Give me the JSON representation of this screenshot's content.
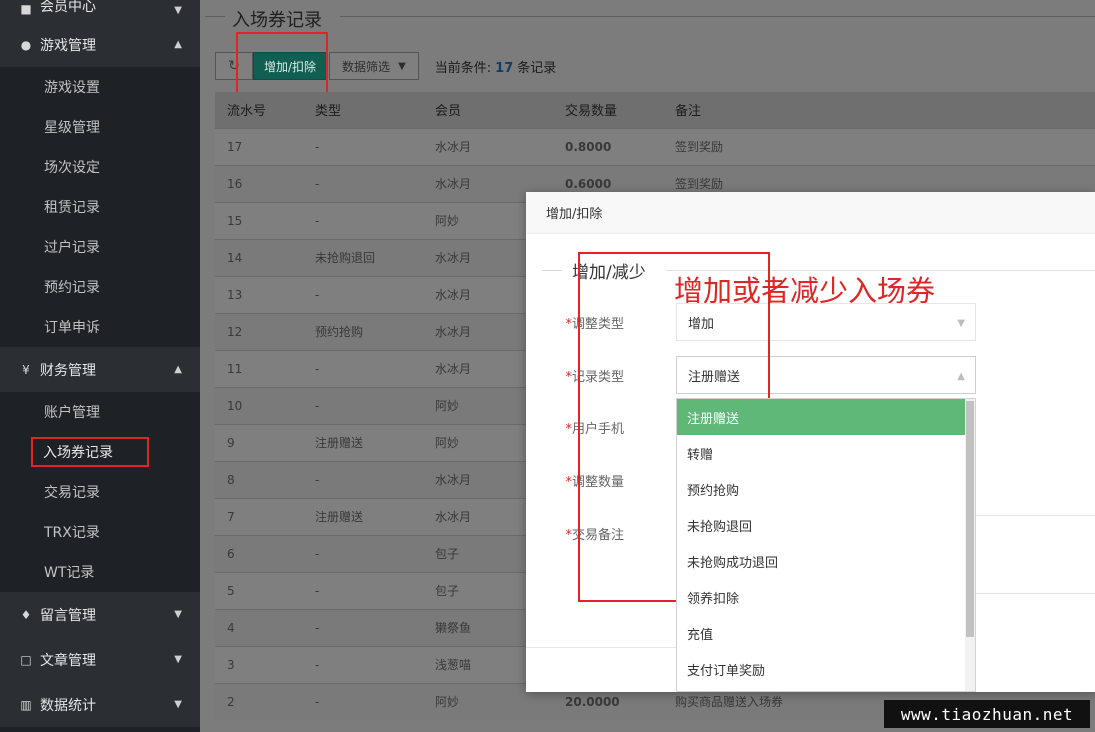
{
  "sidebar": {
    "top_group": {
      "label": "会员中心"
    },
    "groups": [
      {
        "label": "游戏管理",
        "items": [
          "游戏设置",
          "星级管理",
          "场次设定",
          "租赁记录",
          "过户记录",
          "预约记录",
          "订单申诉"
        ]
      },
      {
        "label": "财务管理",
        "icon": "¥",
        "items": [
          "账户管理",
          "入场券记录",
          "交易记录",
          "TRX记录",
          "WT记录"
        ]
      },
      {
        "label": "留言管理",
        "items": []
      },
      {
        "label": "文章管理",
        "items": []
      },
      {
        "label": "数据统计",
        "items": []
      }
    ]
  },
  "main": {
    "page_title": "入场券记录",
    "toolbar": {
      "add_label": "增加/扣除",
      "filter_label": "数据筛选",
      "cond_prefix": "当前条件:",
      "cond_count": "17",
      "cond_suffix": "条记录"
    },
    "table": {
      "headers": [
        "流水号",
        "类型",
        "会员",
        "交易数量",
        "备注"
      ],
      "rows": [
        [
          "17",
          "-",
          "水冰月",
          "0.8000",
          "签到奖励"
        ],
        [
          "16",
          "-",
          "水冰月",
          "0.6000",
          "签到奖励"
        ],
        [
          "15",
          "-",
          "阿妙",
          "",
          ""
        ],
        [
          "14",
          "未抢购退回",
          "水冰月",
          "",
          ""
        ],
        [
          "13",
          "-",
          "水冰月",
          "",
          ""
        ],
        [
          "12",
          "预约抢购",
          "水冰月",
          "",
          ""
        ],
        [
          "11",
          "-",
          "水冰月",
          "",
          ""
        ],
        [
          "10",
          "-",
          "阿妙",
          "",
          ""
        ],
        [
          "9",
          "注册赠送",
          "阿妙",
          "",
          ""
        ],
        [
          "8",
          "-",
          "水冰月",
          "",
          ""
        ],
        [
          "7",
          "注册赠送",
          "水冰月",
          "",
          ""
        ],
        [
          "6",
          "-",
          "包子",
          "",
          ""
        ],
        [
          "5",
          "-",
          "包子",
          "",
          ""
        ],
        [
          "4",
          "-",
          "獭祭鱼",
          "",
          ""
        ],
        [
          "3",
          "-",
          "浅葱喵",
          "",
          ""
        ],
        [
          "2",
          "-",
          "阿妙",
          "20.0000",
          "购买商品赠送入场券"
        ]
      ]
    }
  },
  "modal": {
    "title": "增加/扣除",
    "legend": "增加/减少",
    "annotation": "增加或者减少入场券",
    "fields": [
      {
        "label": "调整类型",
        "value": "增加"
      },
      {
        "label": "记录类型",
        "value": "注册赠送"
      },
      {
        "label": "用户手机"
      },
      {
        "label": "调整数量"
      },
      {
        "label": "交易备注"
      }
    ],
    "dropdown_options": [
      "注册赠送",
      "转赠",
      "预约抢购",
      "未抢购退回",
      "未抢购成功退回",
      "领养扣除",
      "充值",
      "支付订单奖励"
    ]
  },
  "watermark": "www.tiaozhuan.net"
}
